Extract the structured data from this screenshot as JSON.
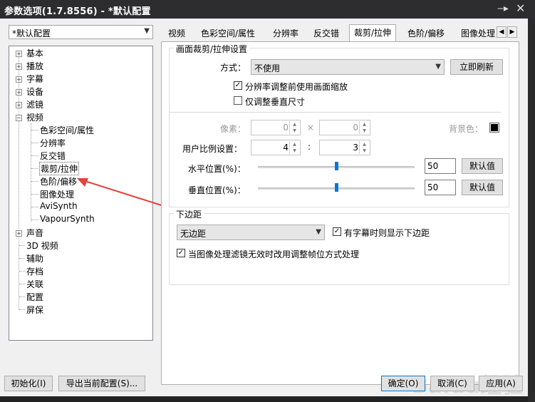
{
  "window": {
    "title": "参数选项(1.7.8556) - *默认配置",
    "pin_icon": "pin-icon",
    "close_icon": "close-icon"
  },
  "profile_select": {
    "value": "*默认配置"
  },
  "tree": {
    "items": [
      {
        "label": "基本",
        "expander": "+"
      },
      {
        "label": "播放",
        "expander": "+"
      },
      {
        "label": "字幕",
        "expander": "+"
      },
      {
        "label": "设备",
        "expander": "+"
      },
      {
        "label": "滤镜",
        "expander": "+"
      },
      {
        "label": "视频",
        "expander": "−"
      },
      {
        "label": "色彩空间/属性"
      },
      {
        "label": "分辨率"
      },
      {
        "label": "反交错"
      },
      {
        "label": "裁剪/拉伸"
      },
      {
        "label": "色阶/偏移"
      },
      {
        "label": "图像处理"
      },
      {
        "label": "AviSynth"
      },
      {
        "label": "VapourSynth"
      },
      {
        "label": "声音",
        "expander": "+"
      },
      {
        "label": "3D 视频"
      },
      {
        "label": "辅助"
      },
      {
        "label": "存档"
      },
      {
        "label": "关联"
      },
      {
        "label": "配置"
      },
      {
        "label": "屏保"
      }
    ]
  },
  "tabs": [
    "视频",
    "色彩空间/属性",
    "分辨率",
    "反交错",
    "裁剪/拉伸",
    "色阶/偏移",
    "图像处理"
  ],
  "active_tab": "裁剪/拉伸",
  "crop_group": {
    "legend": "画面裁剪/拉伸设置",
    "mode_label": "方式：",
    "mode_value": "不使用",
    "refresh_button": "立即刷新",
    "chk_scale": {
      "label": "分辨率调整前使用画面缩放",
      "checked": true
    },
    "chk_vertical": {
      "label": "仅调整垂直尺寸",
      "checked": false
    },
    "pixel_label": "像素：",
    "pixel_w": "0",
    "pixel_x": "×",
    "pixel_h": "0",
    "bg_label": "背景色：",
    "bg_color": "#000000",
    "ratio_label": "用户比例设置：",
    "ratio_w": "4",
    "ratio_sep": ":",
    "ratio_h": "3",
    "hpos_label": "水平位置(%)：",
    "hpos_value": "50",
    "hpos_default": "默认值",
    "vpos_label": "垂直位置(%)：",
    "vpos_value": "50",
    "vpos_default": "默认值"
  },
  "margin_group": {
    "legend": "下边距",
    "select_value": "无边距",
    "chk_subtitle": {
      "label": "有字幕时则显示下边距",
      "checked": true
    },
    "chk_filter": {
      "label": "当图像处理滤镜无效时改用调整帧位方式处理",
      "checked": true
    }
  },
  "footer": {
    "init": "初始化(I)",
    "export": "导出当前配置(S)...",
    "ok": "确定(O)",
    "cancel": "取消(C)",
    "apply": "应用(A)"
  },
  "watermark": "Baidu经验",
  "colors": {
    "accent": "#0078d7",
    "annotation_arrow": "#e8403a",
    "titlebar": "#2d2d30"
  }
}
